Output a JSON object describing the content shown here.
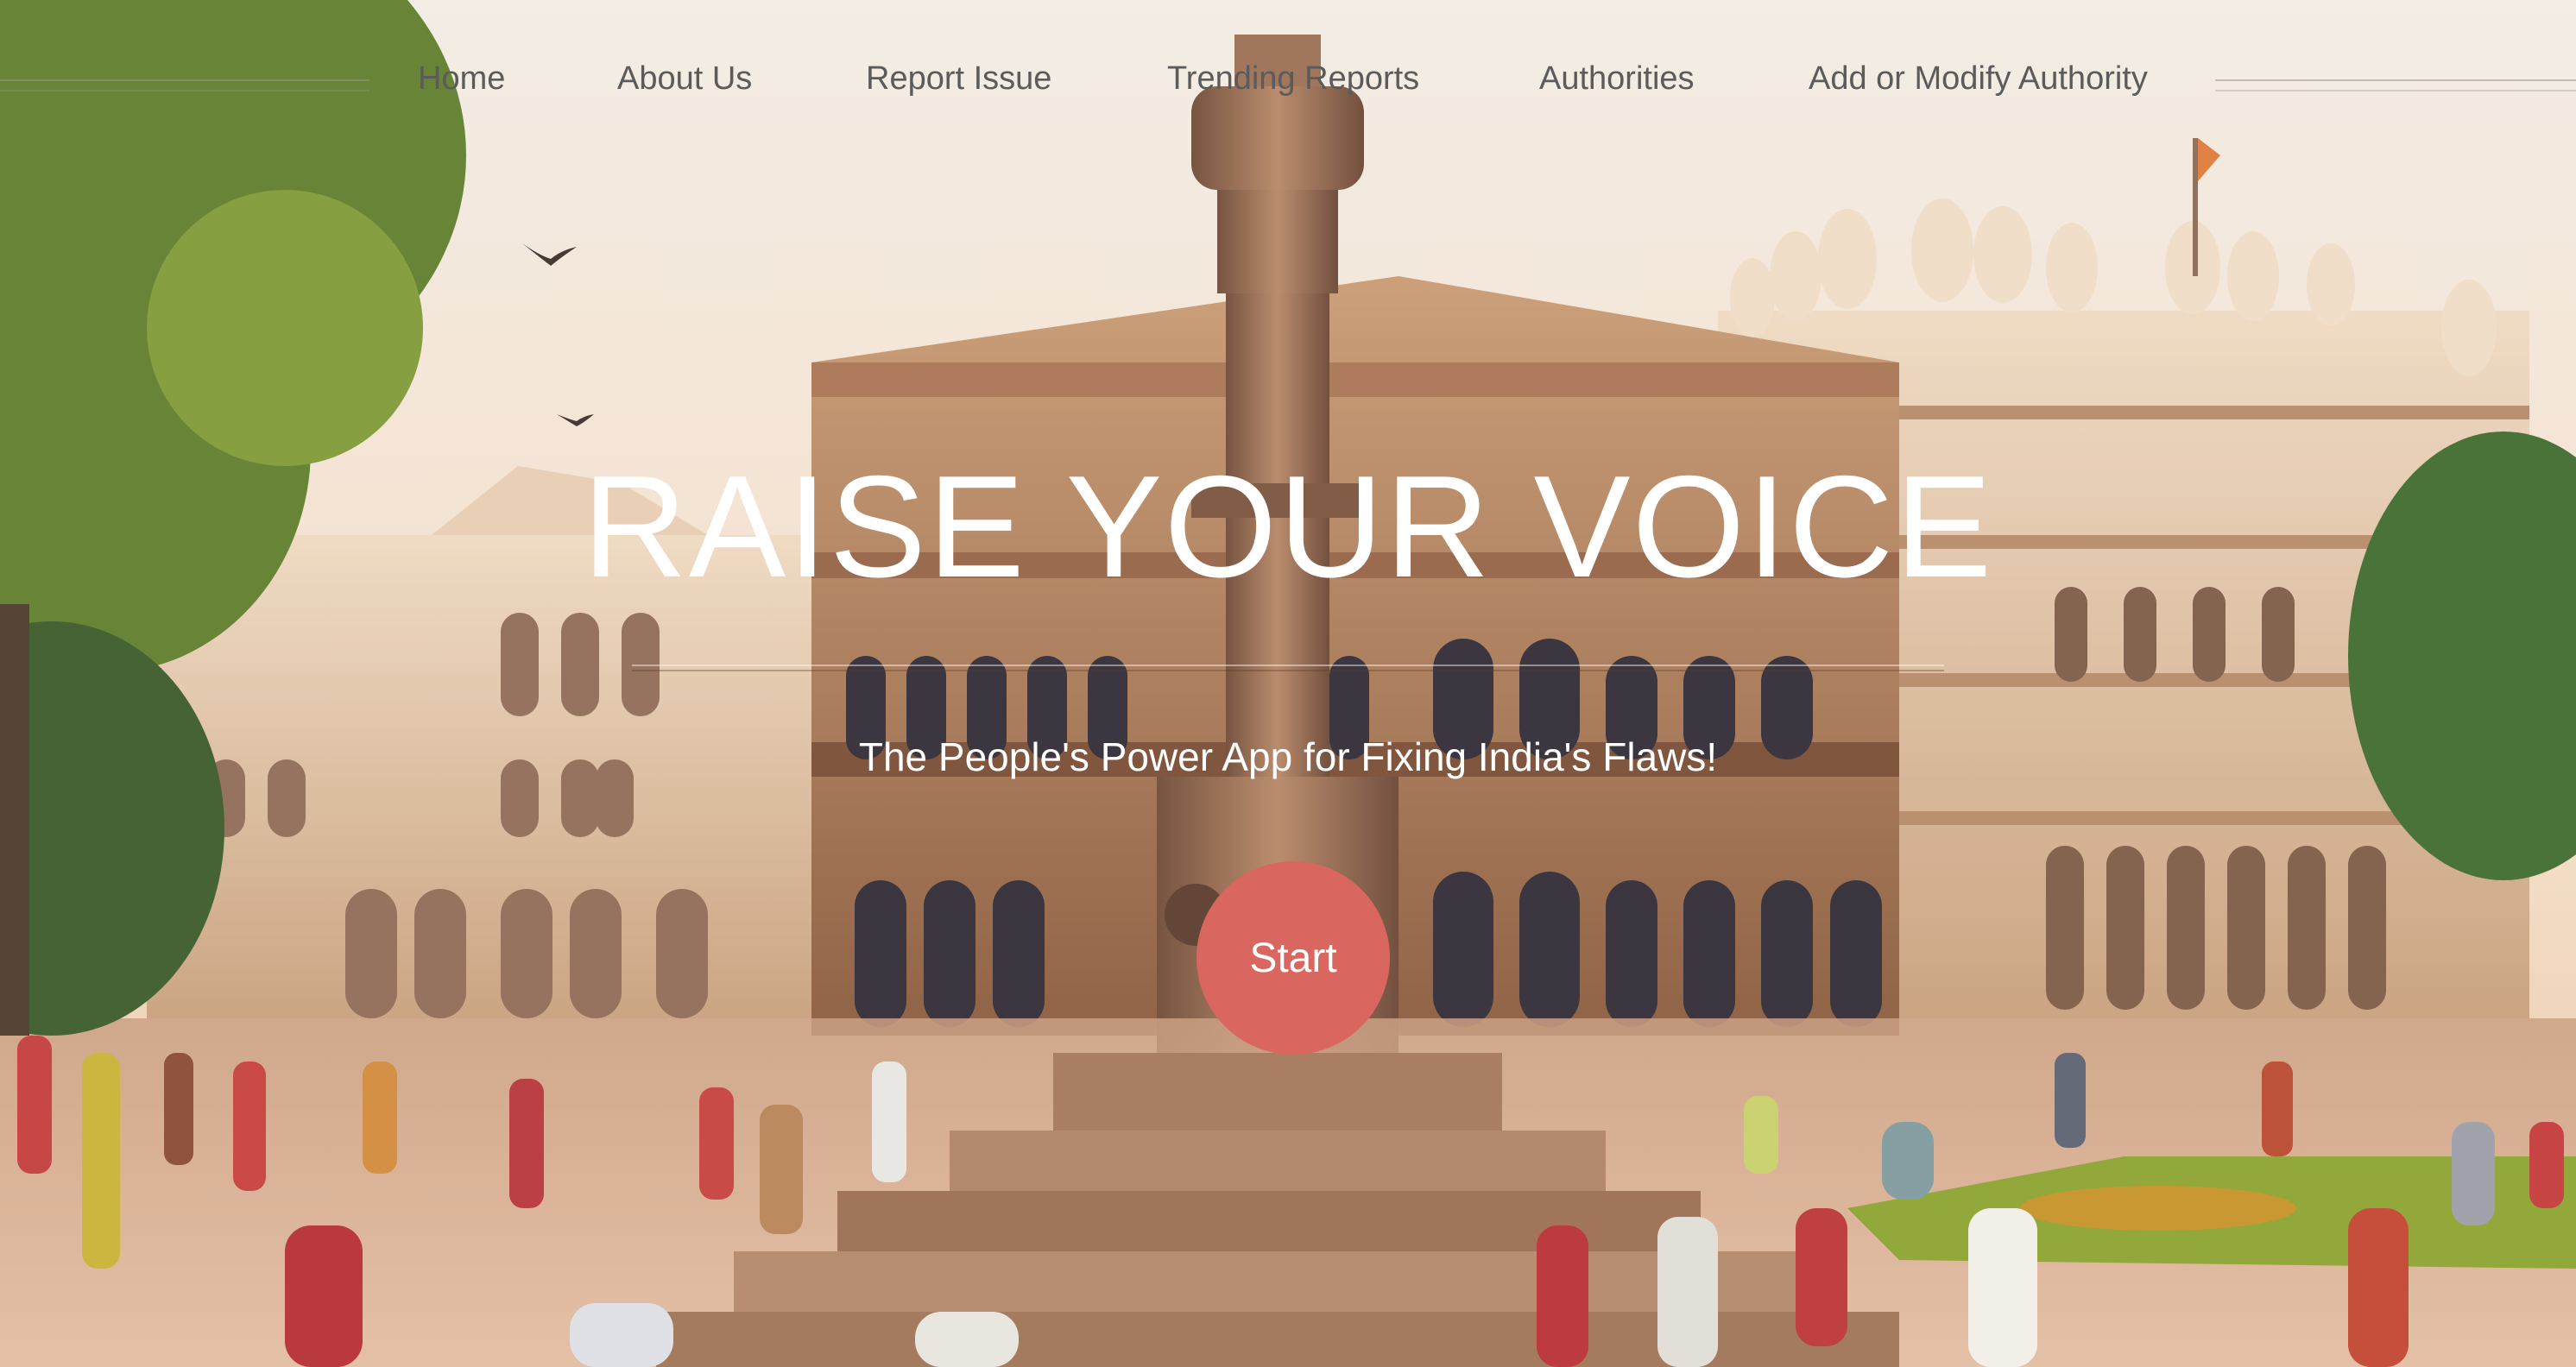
{
  "nav": {
    "items": [
      {
        "label": "Home"
      },
      {
        "label": "About Us"
      },
      {
        "label": "Report Issue"
      },
      {
        "label": "Trending Reports"
      },
      {
        "label": "Authorities"
      },
      {
        "label": "Add or Modify Authority"
      }
    ]
  },
  "hero": {
    "title": "RAISE YOUR VOICE",
    "subtitle": "The People's Power App for Fixing India's Flaws!",
    "start_label": "Start"
  },
  "colors": {
    "accent": "#d9675f",
    "nav_text": "#5b5b5b",
    "hero_text": "#ffffff"
  },
  "background": {
    "image_subject": "heritage-palace-square-photo"
  }
}
